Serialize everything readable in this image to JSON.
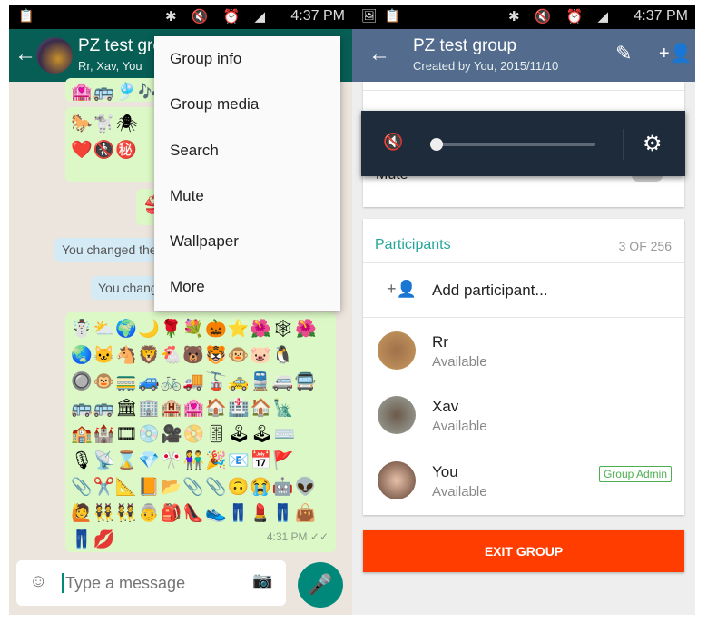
{
  "status": {
    "time": "4:37 PM"
  },
  "chat": {
    "title": "PZ test group",
    "subtitle": "Rr, Xav, You",
    "emoji_rows_top": [
      "🏩🚌🎐🎶",
      "🐎🐩🕷",
      "❤️🚷㊙️"
    ],
    "emoji_small": "👙",
    "system_messages": [
      "You changed the",
      "You chang"
    ],
    "emoji_rows_main": [
      "☃️⛅🌍🌙🌹💐🎃⭐🌺🕸🌺",
      "🌏🐱🐴🦁🐔🐻🐯🐵🐷🐧",
      "🔘🐵🚃🚙🚲🚚🚡🚕🚆🚐🚍",
      "🚌🚌🏛🏢🏨🏩🏠🏥🏠🗽",
      "🏫🏰🎞💿🎥📀🎚🕹🕹⌨️",
      "🎙📡⌛💎🎌👫🎉📧📅🚩",
      "📎✂️📐📙📂📎📎🙃😭🤖👽",
      "🙋👯👯👵🎒👠👟👖💄👖👜",
      "👖💋"
    ],
    "message_time": "4:31 PM",
    "input_placeholder": "Type a message",
    "menu": [
      "Group info",
      "Group media",
      "Search",
      "Mute",
      "Wallpaper",
      "More"
    ],
    "accent": "#075e54"
  },
  "info": {
    "title": "PZ test group",
    "subtitle": "Created by You, 2015/11/10",
    "mute_label": "Mute",
    "volume_level": 0,
    "participants_label": "Participants",
    "participants_count": "3 OF 256",
    "add_participant": "Add participant...",
    "participants": [
      {
        "name": "Rr",
        "status": "Available"
      },
      {
        "name": "Xav",
        "status": "Available"
      },
      {
        "name": "You",
        "status": "Available",
        "badge": "Group Admin"
      }
    ],
    "exit_label": "EXIT GROUP",
    "header_color": "#536b8c",
    "exit_color": "#ff3d00"
  }
}
